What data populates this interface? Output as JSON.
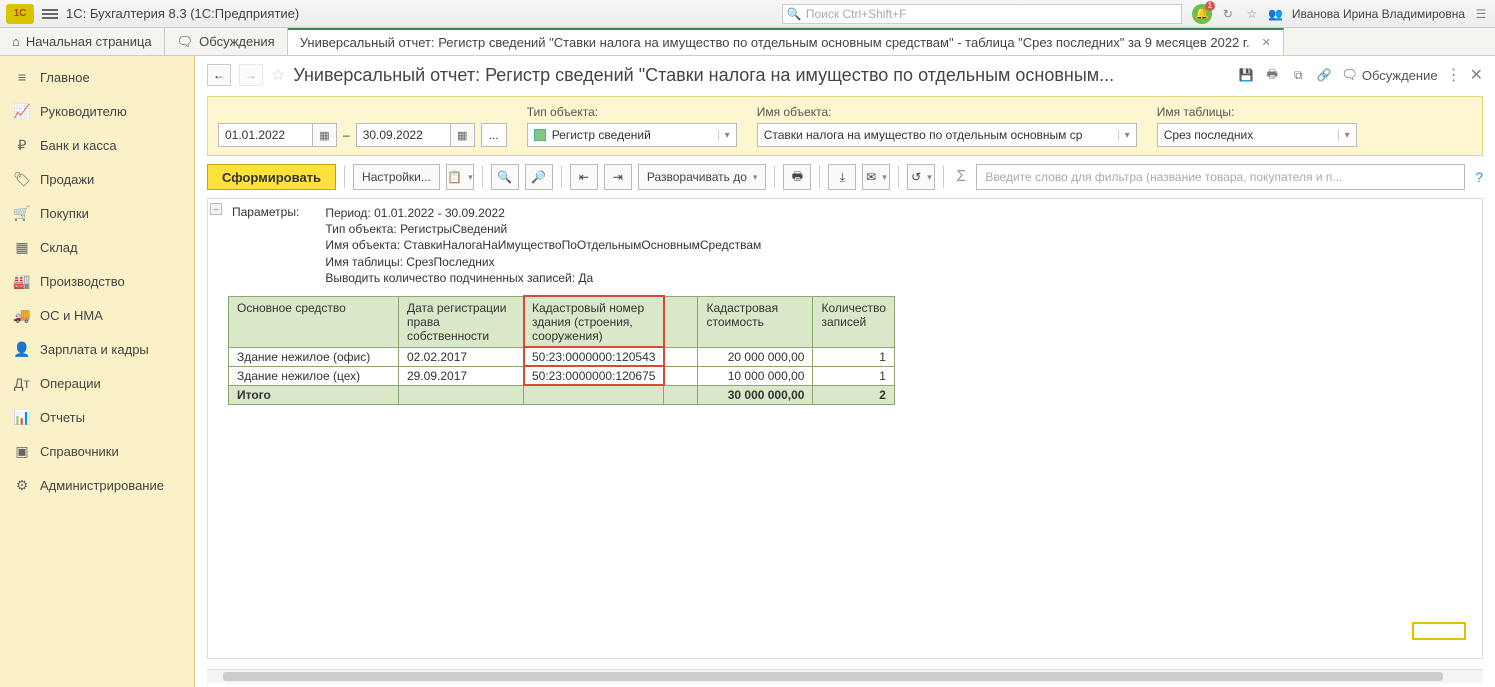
{
  "app": {
    "title": "1С: Бухгалтерия 8.3  (1С:Предприятие)"
  },
  "search": {
    "placeholder": "Поиск Ctrl+Shift+F"
  },
  "user": {
    "name": "Иванова Ирина Владимировна"
  },
  "tabs": {
    "home": "Начальная страница",
    "discuss": "Обсуждения",
    "report": "Универсальный отчет: Регистр сведений \"Ставки налога на имущество по отдельным основным средствам\" - таблица \"Срез последних\" за 9 месяцев 2022 г."
  },
  "sidebar": [
    {
      "label": "Главное"
    },
    {
      "label": "Руководителю"
    },
    {
      "label": "Банк и касса"
    },
    {
      "label": "Продажи"
    },
    {
      "label": "Покупки"
    },
    {
      "label": "Склад"
    },
    {
      "label": "Производство"
    },
    {
      "label": "ОС и НМА"
    },
    {
      "label": "Зарплата и кадры"
    },
    {
      "label": "Операции"
    },
    {
      "label": "Отчеты"
    },
    {
      "label": "Справочники"
    },
    {
      "label": "Администрирование"
    }
  ],
  "header": {
    "title": "Универсальный отчет: Регистр сведений \"Ставки налога на имущество по отдельным основным...",
    "discuss": "Обсуждение"
  },
  "params": {
    "type_label": "Тип объекта:",
    "name_label": "Имя объекта:",
    "table_label": "Имя таблицы:",
    "date_from": "01.01.2022",
    "date_to": "30.09.2022",
    "dash": "–",
    "dots": "...",
    "type_value": "Регистр сведений",
    "name_value": "Ставки налога на имущество по отдельным основным ср",
    "table_value": "Срез последних"
  },
  "toolbar": {
    "form": "Сформировать",
    "settings": "Настройки...",
    "expand": "Разворачивать до",
    "filter_placeholder": "Введите слово для фильтра (название товара, покупателя и п..."
  },
  "report": {
    "params_label": "Параметры:",
    "lines": [
      "Период: 01.01.2022 - 30.09.2022",
      "Тип объекта: РегистрыСведений",
      "Имя объекта: СтавкиНалогаНаИмуществоПоОтдельнымОсновнымСредствам",
      "Имя таблицы: СрезПоследних",
      "Выводить количество подчиненных записей: Да"
    ],
    "headers": {
      "c1": "Основное средство",
      "c2": "Дата регистрации права собственности",
      "c3": "Кадастровый номер здания (строения, сооружения)",
      "c4": "",
      "c5": "Кадастровая стоимость",
      "c6": "Количество записей"
    },
    "rows": [
      {
        "c1": "Здание нежилое (офис)",
        "c2": "02.02.2017",
        "c3": "50:23:0000000:120543",
        "c4": "",
        "c5": "20 000 000,00",
        "c6": "1"
      },
      {
        "c1": "Здание нежилое (цех)",
        "c2": "29.09.2017",
        "c3": "50:23:0000000:120675",
        "c4": "",
        "c5": "10 000 000,00",
        "c6": "1"
      }
    ],
    "total": {
      "label": "Итого",
      "c5": "30 000 000,00",
      "c6": "2"
    }
  }
}
